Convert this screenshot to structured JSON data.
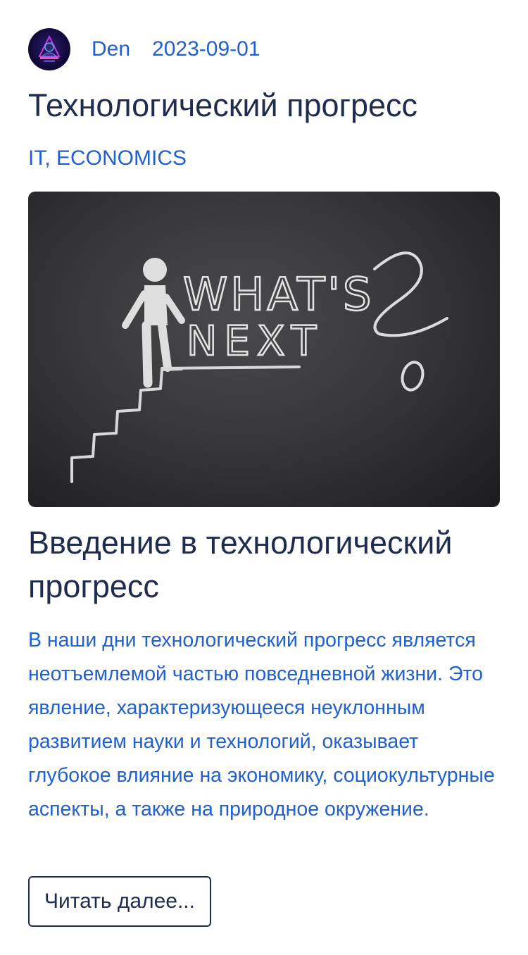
{
  "post": {
    "author": "Den",
    "date": "2023-09-01",
    "title": "Технологический прогресс",
    "tags": "IT, ECONOMICS",
    "image": {
      "chalk_text_line1": "WHAT'S",
      "chalk_text_line2": "NEXT"
    },
    "subtitle": "Введение в технологический прогресс",
    "excerpt": "В наши дни технологический прогресс является неотъемлемой частью повседневной жизни. Это явление, характеризующееся неуклонным развитием науки и технологий, оказывает глубокое влияние на экономику, социокультурные аспекты, а также на природное окружение.",
    "read_more_label": "Читать далее..."
  },
  "colors": {
    "link": "#2060d0",
    "heading": "#1f2c4d",
    "background": "#ffffff"
  },
  "icons": {
    "avatar": "hooded-figure-logo-icon"
  }
}
